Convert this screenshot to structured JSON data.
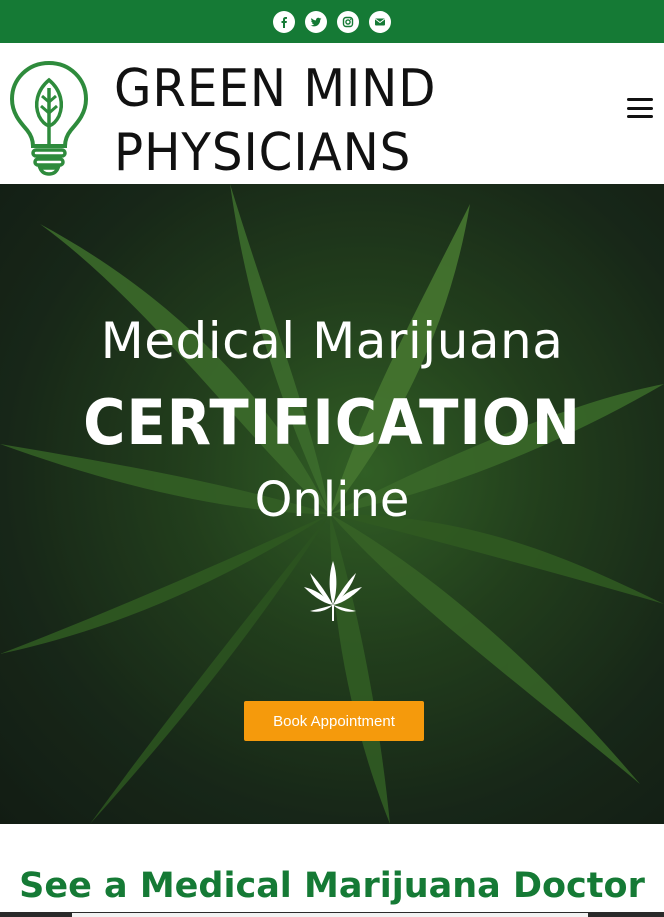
{
  "topbar": {
    "background": "#157a35",
    "social": [
      {
        "name": "facebook-icon"
      },
      {
        "name": "twitter-icon"
      },
      {
        "name": "instagram-icon"
      },
      {
        "name": "envelope-icon"
      }
    ]
  },
  "header": {
    "logo_line1": "GREEN MIND",
    "logo_line2": "PHYSICIANS",
    "logo_icon": "lightbulb-leaf-icon",
    "menu_icon": "hamburger-menu-icon"
  },
  "hero": {
    "line1": "Medical Marijuana",
    "line2": "CERTIFICATION",
    "line3": "Online",
    "leaf_icon": "cannabis-leaf-icon",
    "button_label": "Book Appointment",
    "button_color": "#f59a0c"
  },
  "section": {
    "title": "See a Medical Marijuana Doctor",
    "title_color": "#157a35"
  }
}
